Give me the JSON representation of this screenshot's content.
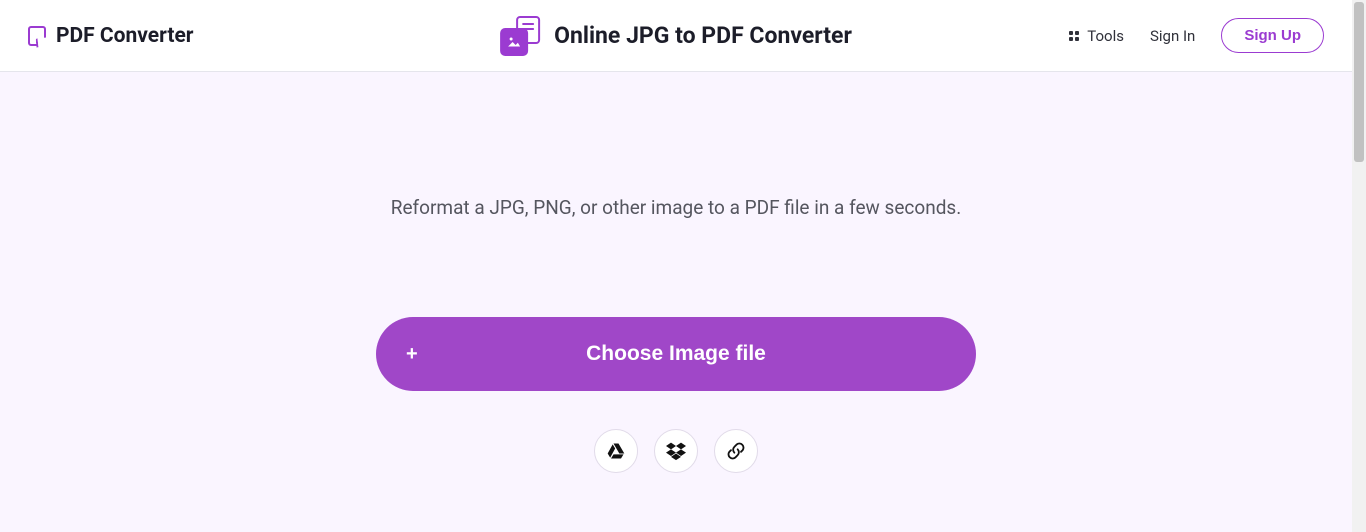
{
  "header": {
    "logo_text": "PDF Converter",
    "page_title": "Online JPG to PDF Converter",
    "nav": {
      "tools_label": "Tools",
      "signin_label": "Sign In",
      "signup_label": "Sign Up"
    }
  },
  "main": {
    "subtitle": "Reformat a JPG, PNG, or other image to a PDF file in a few seconds.",
    "choose_label": "Choose Image file",
    "plus_glyph": "+"
  }
}
